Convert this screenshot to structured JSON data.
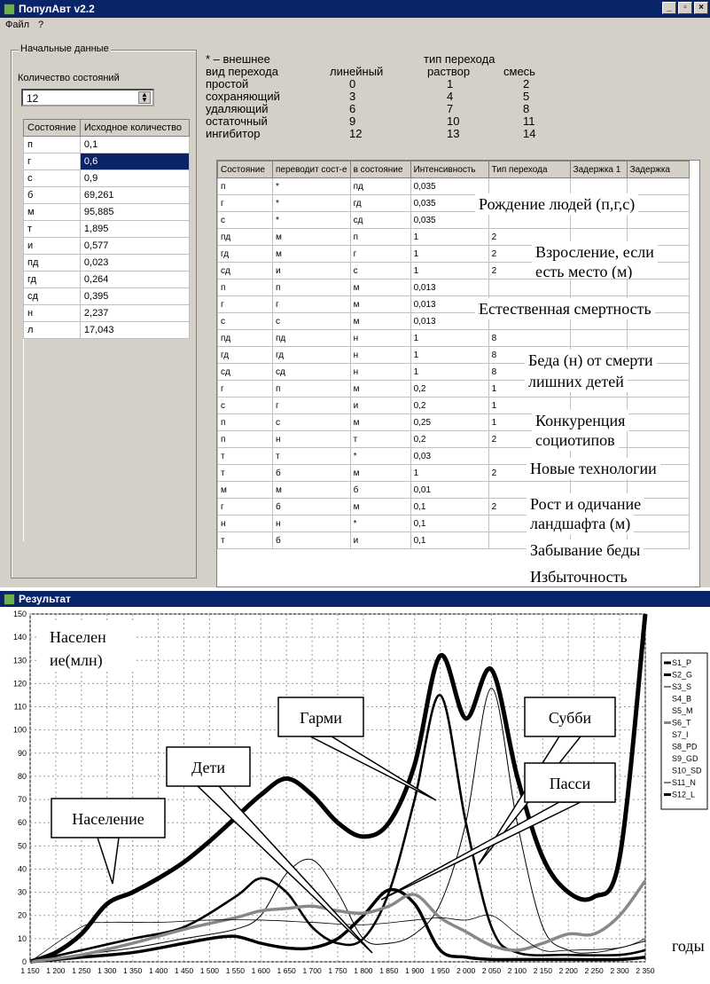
{
  "window": {
    "title": "ПопулАвт v2.2",
    "menu": [
      "Файл",
      "?"
    ]
  },
  "initial": {
    "group_title": "Начальные данные",
    "count_label": "Количество состояний",
    "count_value": "12",
    "headers": [
      "Состояние",
      "Исходное количество"
    ],
    "rows": [
      [
        "п",
        "0,1"
      ],
      [
        "г",
        "0,6"
      ],
      [
        "с",
        "0,9"
      ],
      [
        "б",
        "69,261"
      ],
      [
        "м",
        "95,885"
      ],
      [
        "т",
        "1,895"
      ],
      [
        "и",
        "0,577"
      ],
      [
        "пд",
        "0,023"
      ],
      [
        "гд",
        "0,264"
      ],
      [
        "сд",
        "0,395"
      ],
      [
        "н",
        "2,237"
      ],
      [
        "л",
        "17,043"
      ]
    ]
  },
  "legend_text": {
    "external": "* – внешнее",
    "type_header": "тип перехода",
    "kind_header": "вид перехода",
    "cols": [
      "линейный",
      "раствор",
      "смесь"
    ],
    "rows": [
      [
        "простой",
        "0",
        "1",
        "2"
      ],
      [
        "сохраняющий",
        "3",
        "4",
        "5"
      ],
      [
        "удаляющий",
        "6",
        "7",
        "8"
      ],
      [
        "остаточный",
        "9",
        "10",
        "11"
      ],
      [
        "ингибитор",
        "12",
        "13",
        "14"
      ]
    ]
  },
  "transitions": {
    "headers": [
      "Состояние",
      "переводит сост-е",
      "в состояние",
      "Интенсивность",
      "Тип перехода",
      "Задержка 1",
      "Задержка"
    ],
    "rows": [
      [
        "п",
        "*",
        "пд",
        "0,035",
        ""
      ],
      [
        "г",
        "*",
        "гд",
        "0,035",
        ""
      ],
      [
        "с",
        "*",
        "сд",
        "0,035",
        ""
      ],
      [
        "пд",
        "м",
        "п",
        "1",
        "2"
      ],
      [
        "гд",
        "м",
        "г",
        "1",
        "2"
      ],
      [
        "сд",
        "и",
        "с",
        "1",
        "2"
      ],
      [
        "п",
        "п",
        "м",
        "0,013",
        ""
      ],
      [
        "г",
        "г",
        "м",
        "0,013",
        ""
      ],
      [
        "с",
        "с",
        "м",
        "0,013",
        ""
      ],
      [
        "пд",
        "пд",
        "н",
        "1",
        "8"
      ],
      [
        "гд",
        "гд",
        "н",
        "1",
        "8"
      ],
      [
        "сд",
        "сд",
        "н",
        "1",
        "8"
      ],
      [
        "г",
        "п",
        "м",
        "0,2",
        "1"
      ],
      [
        "с",
        "г",
        "и",
        "0,2",
        "1"
      ],
      [
        "п",
        "с",
        "м",
        "0,25",
        "1"
      ],
      [
        "п",
        "н",
        "т",
        "0,2",
        "2"
      ],
      [
        "т",
        "т",
        "*",
        "0,03",
        ""
      ],
      [
        "т",
        "б",
        "м",
        "1",
        "2"
      ],
      [
        "м",
        "м",
        "б",
        "0,01",
        ""
      ],
      [
        "г",
        "б",
        "м",
        "0,1",
        "2"
      ],
      [
        "н",
        "н",
        "*",
        "0,1",
        ""
      ],
      [
        "т",
        "б",
        "и",
        "0,1",
        ""
      ]
    ]
  },
  "annotations": [
    "Рождение людей (п,г,с)",
    "Взросление, если",
    "есть место (м)",
    "Естественная смертность",
    "Беда (н) от смерти",
    "лишних детей",
    "Конкуренция",
    "социотипов",
    "Новые технологии",
    "Рост и  одичание",
    "ландшафта (м)",
    "Забывание беды",
    "Избыточность"
  ],
  "result": {
    "title": "Результат"
  },
  "chart_data": {
    "type": "line",
    "ylim": [
      0,
      150
    ],
    "xlim": [
      1150,
      2350
    ],
    "yticks": [
      0,
      10,
      20,
      30,
      40,
      50,
      60,
      70,
      80,
      90,
      100,
      110,
      120,
      130,
      140,
      150
    ],
    "xticks": [
      "1 150",
      "1 200",
      "1 250",
      "1 300",
      "1 350",
      "1 400",
      "1 450",
      "1 500",
      "1 550",
      "1 600",
      "1 650",
      "1 700",
      "1 750",
      "1 800",
      "1 850",
      "1 900",
      "1 950",
      "2 000",
      "2 050",
      "2 100",
      "2 150",
      "2 200",
      "2 250",
      "2 300",
      "2 350"
    ],
    "ylabel": "Население(млн)",
    "xlabel": "годы",
    "legend": [
      "S1_P",
      "S2_G",
      "S3_S",
      "S4_B",
      "S5_M",
      "S6_T",
      "S7_I",
      "S8_PD",
      "S9_GD",
      "S10_SD",
      "S11_N",
      "S12_L"
    ],
    "callouts": [
      "Население",
      "Дети",
      "Гарми",
      "Субби",
      "Пасси"
    ],
    "series": [
      {
        "name": "S12_L",
        "x": [
          1150,
          1200,
          1250,
          1300,
          1350,
          1400,
          1450,
          1500,
          1550,
          1600,
          1650,
          1700,
          1750,
          1800,
          1850,
          1900,
          1950,
          2000,
          2050,
          2100,
          2150,
          2200,
          2250,
          2300,
          2350
        ],
        "y": [
          0,
          4,
          12,
          25,
          30,
          36,
          43,
          52,
          62,
          72,
          79,
          72,
          60,
          54,
          60,
          85,
          132,
          105,
          126,
          80,
          45,
          30,
          28,
          45,
          152
        ]
      },
      {
        "name": "S1_P",
        "x": [
          1150,
          1250,
          1350,
          1450,
          1500,
          1550,
          1600,
          1650,
          1700,
          1750,
          1800,
          1850,
          1900,
          1950,
          2000,
          2050,
          2100,
          2200,
          2300,
          2350
        ],
        "y": [
          0,
          2,
          4,
          8,
          10,
          11,
          8,
          6,
          6,
          10,
          20,
          31,
          25,
          5,
          2,
          1,
          1,
          1,
          1,
          2
        ]
      },
      {
        "name": "S2_G",
        "x": [
          1150,
          1250,
          1350,
          1450,
          1550,
          1600,
          1650,
          1700,
          1750,
          1800,
          1850,
          1900,
          1950,
          2000,
          2050,
          2100,
          2200,
          2300,
          2350
        ],
        "y": [
          0,
          5,
          10,
          15,
          28,
          36,
          30,
          15,
          8,
          10,
          30,
          70,
          115,
          60,
          15,
          4,
          3,
          3,
          5
        ]
      },
      {
        "name": "S3_S",
        "x": [
          1150,
          1250,
          1350,
          1450,
          1550,
          1600,
          1650,
          1700,
          1750,
          1800,
          1850,
          1900,
          1950,
          2000,
          2050,
          2100,
          2150,
          2200,
          2250,
          2300,
          2350
        ],
        "y": [
          0,
          3,
          6,
          10,
          14,
          20,
          38,
          44,
          30,
          10,
          8,
          12,
          25,
          60,
          118,
          60,
          15,
          5,
          4,
          6,
          9
        ]
      },
      {
        "name": "S6_T",
        "x": [
          1150,
          1250,
          1350,
          1450,
          1550,
          1600,
          1650,
          1700,
          1750,
          1800,
          1850,
          1900,
          1950,
          2000,
          2050,
          2100,
          2150,
          2200,
          2250,
          2300,
          2350
        ],
        "y": [
          0,
          3,
          8,
          14,
          19,
          22,
          23,
          24,
          22,
          21,
          24,
          29,
          19,
          13,
          7,
          5,
          8,
          12,
          12,
          20,
          35
        ]
      },
      {
        "name": "S4_B",
        "x": [
          1150,
          1250,
          1300,
          1400,
          1500,
          1600,
          1700,
          1800,
          1900,
          1950,
          2000,
          2050,
          2100,
          2150,
          2200,
          2300,
          2350
        ],
        "y": [
          0,
          15,
          17,
          17,
          18,
          18,
          17,
          16,
          18,
          19,
          18,
          20,
          12,
          5,
          5,
          6,
          10
        ]
      }
    ]
  }
}
